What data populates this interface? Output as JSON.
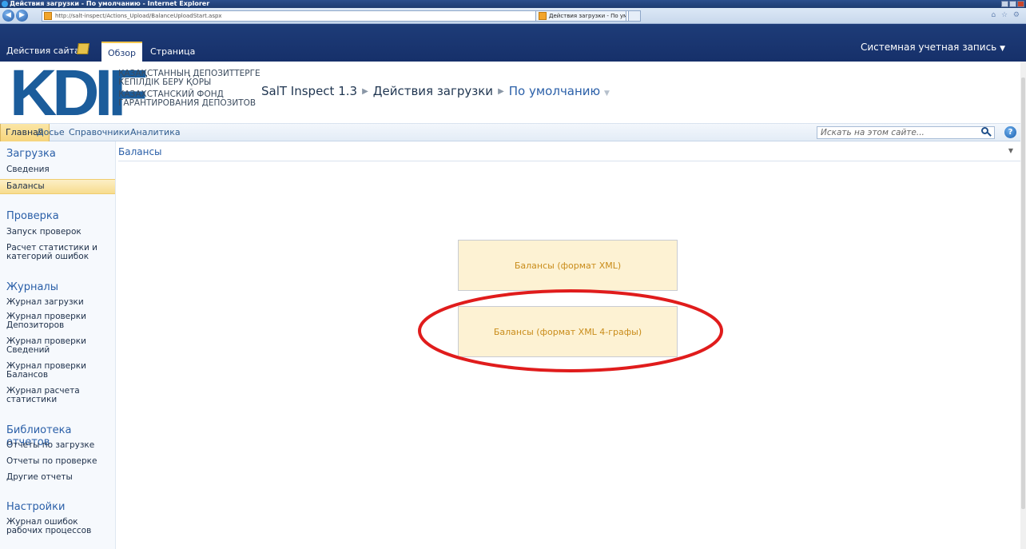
{
  "browser": {
    "window_title": "Действия загрузки - По умолчанию - Internet Explorer",
    "url": "http://salt-inspect/Actions_Upload/BalanceUploadStart.aspx",
    "tab_title": "Действия загрузки - По ум..."
  },
  "ribbon": {
    "site_actions": "Действия сайта",
    "tabs": [
      {
        "label": "Обзор",
        "active": true
      },
      {
        "label": "Страница",
        "active": false
      }
    ],
    "user": "Системная учетная запись"
  },
  "header": {
    "logo": "KDIF",
    "logo_lines": [
      "ҚАЗАҚСТАННЫҢ ДЕПОЗИТТЕРГЕ",
      "КЕПІЛДІК БЕРУ ҚОРЫ",
      "КАЗАХСТАНСКИЙ ФОНД",
      "ГАРАНТИРОВАНИЯ ДЕПОЗИТОВ"
    ],
    "breadcrumb": [
      "SalT Inspect 1.3",
      "Действия загрузки",
      "По умолчанию"
    ]
  },
  "topnav": {
    "items": [
      "Главная",
      "Досье",
      "Справочники",
      "Аналитика"
    ],
    "active": "Главная",
    "search_placeholder": "Искать на этом сайте..."
  },
  "leftnav": {
    "sections": [
      {
        "heading": "Загрузка",
        "items": [
          "Сведения",
          "Балансы"
        ]
      },
      {
        "heading": "Проверка",
        "items": [
          "Запуск проверок",
          "Расчет статистики и категорий ошибок"
        ]
      },
      {
        "heading": "Журналы",
        "items": [
          "Журнал загрузки",
          "Журнал проверки Депозиторов",
          "Журнал проверки Сведений",
          "Журнал проверки Балансов",
          "Журнал расчета статистики"
        ]
      },
      {
        "heading": "Библиотека отчетов",
        "items": [
          "Отчеты по загрузке",
          "Отчеты по проверке",
          "Другие отчеты"
        ]
      },
      {
        "heading": "Настройки",
        "items": [
          "Журнал ошибок рабочих процессов"
        ]
      }
    ],
    "active_item": "Балансы"
  },
  "main": {
    "title": "Балансы",
    "buttons": [
      "Балансы (формат XML)",
      "Балансы (формат XML 4-графы)"
    ],
    "highlighted_button": "Балансы (формат XML 4-графы)",
    "highlight_color": "#e01c1c"
  }
}
